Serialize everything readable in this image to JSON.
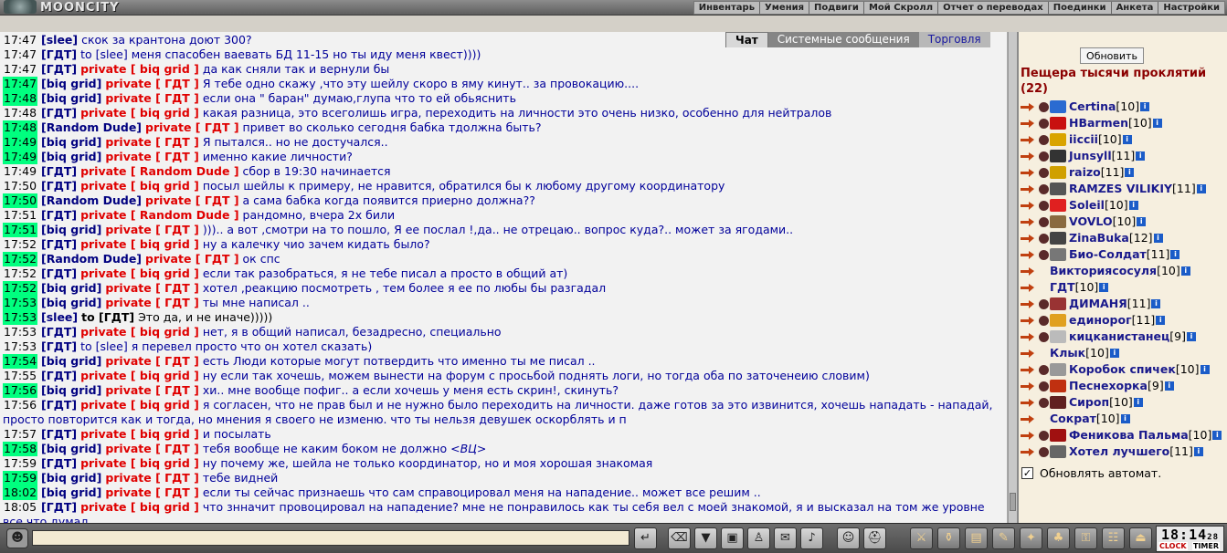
{
  "app": {
    "title": "MOONCITY"
  },
  "menu": [
    "Инвентарь",
    "Умения",
    "Подвиги",
    "Мой Скролл",
    "Отчет о переводах",
    "Поединки",
    "Анкета",
    "Настройки"
  ],
  "tabs": {
    "chat": "Чат",
    "system": "Системные сообщения",
    "trade": "Торговля"
  },
  "chat": [
    {
      "t": "17:47",
      "hl": false,
      "nick": "[slee]",
      "msg": "скок за крантона доют 300?"
    },
    {
      "t": "17:47",
      "hl": false,
      "nick": "[ГДТ]",
      "to": "to [slee]",
      "msg": "меня спасобен ваевать БД 11-15 но ты иду меня квест))))"
    },
    {
      "t": "17:47",
      "hl": false,
      "nick": "[ГДТ]",
      "priv": "private [ biq grid ]",
      "msg": "да как сняли так и вернули бы"
    },
    {
      "t": "17:47",
      "hl": true,
      "nick": "[biq grid]",
      "priv": "private [ ГДТ ]",
      "msg": "Я тебе одно скажу ,что эту шейлу скоро в яму кинут.. за провокацию...."
    },
    {
      "t": "17:48",
      "hl": true,
      "nick": "[biq grid]",
      "priv": "private [ ГДТ ]",
      "msg": "если она \" баран\" думаю,глупа что то ей обьяснить"
    },
    {
      "t": "17:48",
      "hl": false,
      "nick": "[ГДТ]",
      "priv": "private [ biq grid ]",
      "msg": "какая разница, это всеголишь игра, переходить на личности это очень низко, особенно для нейтралов"
    },
    {
      "t": "17:48",
      "hl": true,
      "nick": "[Random Dude]",
      "priv": "private [ ГДТ ]",
      "msg": "привет во сколько сегодня бабка тдолжна быть?"
    },
    {
      "t": "17:49",
      "hl": true,
      "nick": "[biq grid]",
      "priv": "private [ ГДТ ]",
      "msg": "Я пытался.. но не достучался.."
    },
    {
      "t": "17:49",
      "hl": true,
      "nick": "[biq grid]",
      "priv": "private [ ГДТ ]",
      "msg": "именно какие личности?"
    },
    {
      "t": "17:49",
      "hl": false,
      "nick": "[ГДТ]",
      "priv": "private [ Random Dude ]",
      "msg": "сбор в 19:30 начинается"
    },
    {
      "t": "17:50",
      "hl": false,
      "nick": "[ГДТ]",
      "priv": "private [ biq grid ]",
      "msg": "посыл шейлы к примеру, не нравится, обратился бы к любому другому координатору"
    },
    {
      "t": "17:50",
      "hl": true,
      "nick": "[Random Dude]",
      "priv": "private [ ГДТ ]",
      "msg": "а сама бабка когда появится приерно должна??"
    },
    {
      "t": "17:51",
      "hl": false,
      "nick": "[ГДТ]",
      "priv": "private [ Random Dude ]",
      "msg": "рандомно, вчера 2х били"
    },
    {
      "t": "17:51",
      "hl": true,
      "nick": "[biq grid]",
      "priv": "private [ ГДТ ]",
      "msg": "))).. а вот ,смотри на то пошло, Я ее послал !,да.. не отрецаю.. вопрос куда?.. может за ягодами.."
    },
    {
      "t": "17:52",
      "hl": false,
      "nick": "[ГДТ]",
      "priv": "private [ biq grid ]",
      "msg": "ну а калечку чио зачем кидать было?"
    },
    {
      "t": "17:52",
      "hl": true,
      "nick": "[Random Dude]",
      "priv": "private [ ГДТ ]",
      "msg": "ок спс"
    },
    {
      "t": "17:52",
      "hl": false,
      "nick": "[ГДТ]",
      "priv": "private [ biq grid ]",
      "msg": "если так разобраться, я не тебе писал а просто в общий ат)"
    },
    {
      "t": "17:52",
      "hl": true,
      "nick": "[biq grid]",
      "priv": "private [ ГДТ ]",
      "msg": "хотел ,реакцию посмотреть , тем более я ее по любы бы разгадал"
    },
    {
      "t": "17:53",
      "hl": true,
      "nick": "[biq grid]",
      "priv": "private [ ГДТ ]",
      "msg": "ты мне написал .."
    },
    {
      "t": "17:53",
      "hl": true,
      "nick": "[slee]",
      "to": "to [ГДТ]",
      "toDark": true,
      "msg": "Это да, и не иначе)))))",
      "dark": true
    },
    {
      "t": "17:53",
      "hl": false,
      "nick": "[ГДТ]",
      "priv": "private [ biq grid ]",
      "msg": "нет, я в общий написал, безадресно, специально"
    },
    {
      "t": "17:53",
      "hl": false,
      "nick": "[ГДТ]",
      "to": "to [slee]",
      "msg": "я перевел просто что он хотел сказать)"
    },
    {
      "t": "17:54",
      "hl": true,
      "nick": "[biq grid]",
      "priv": "private [ ГДТ ]",
      "msg": "есть Люди которые могут потвердить что именно ты ме писал .."
    },
    {
      "t": "17:55",
      "hl": false,
      "nick": "[ГДТ]",
      "priv": "private [ biq grid ]",
      "msg": "ну если так хочешь, можем вынести на форум с просьбой поднять логи, но тогда оба по заточенеию словим)"
    },
    {
      "t": "17:56",
      "hl": true,
      "nick": "[biq grid]",
      "priv": "private [ ГДТ ]",
      "msg": "хи.. мне вообще пофиг.. а если хочешь у меня есть скрин!, скинуть?"
    },
    {
      "t": "17:56",
      "hl": false,
      "wrap": true,
      "nick": "[ГДТ]",
      "priv": "private [ biq grid ]",
      "msg": "я согласен, что не прав был и не нужно было переходить на личности. даже готов за это извинится, хочешь нападать - нападай, просто повторится как и тогда, но мнения я своего не изменю. что ты нельзя девушек оскорблять и п"
    },
    {
      "t": "17:57",
      "hl": false,
      "nick": "[ГДТ]",
      "priv": "private [ biq grid ]",
      "msg": "и посылать"
    },
    {
      "t": "17:58",
      "hl": true,
      "nick": "[biq grid]",
      "priv": "private [ ГДТ ]",
      "msg": "тебя вообще не каким боком не должно",
      "em": "<ВЦ>"
    },
    {
      "t": "17:59",
      "hl": false,
      "nick": "[ГДТ]",
      "priv": "private [ biq grid ]",
      "msg": "ну почему же, шейла не только координатор, но и моя хорошая знакомая"
    },
    {
      "t": "17:59",
      "hl": true,
      "nick": "[biq grid]",
      "priv": "private [ ГДТ ]",
      "msg": "тебе видней"
    },
    {
      "t": "18:02",
      "hl": true,
      "nick": "[biq grid]",
      "priv": "private [ ГДТ ]",
      "msg": "если ты сейчас признаешь что сам справоцировал меня на нападение.. может все решим .."
    },
    {
      "t": "18:05",
      "hl": false,
      "wrap": true,
      "nick": "[ГДТ]",
      "priv": "private [ biq grid ]",
      "msg": "что знначит провоцировал на нападение? мне не понравилось как ты себя вел с моей знакомой, я и высказал на том же уровне все что думал"
    }
  ],
  "side": {
    "refresh": "Обновить",
    "room": "Пещера тысячи проклятий",
    "count": "(22)",
    "auto_refresh": "Обновлять автомат.",
    "users": [
      {
        "name": "Certina",
        "lvl": "[10]",
        "clan": "#2a6bd1"
      },
      {
        "name": "HBarmen",
        "lvl": "[10]",
        "clan": "#c81010"
      },
      {
        "name": "iiccii",
        "lvl": "[10]",
        "clan": "#d9a400"
      },
      {
        "name": "Junsyll",
        "lvl": "[11]",
        "clan": "#333333"
      },
      {
        "name": "raizo",
        "lvl": "[11]",
        "clan": "#d0a000"
      },
      {
        "name": "RAMZES VILIKIY",
        "lvl": "[11]",
        "clan": "#555555"
      },
      {
        "name": "Soleil",
        "lvl": "[10]",
        "clan": "#e02020"
      },
      {
        "name": "VOVLO",
        "lvl": "[10]",
        "clan": "#8a6a40"
      },
      {
        "name": "ZinaBuka",
        "lvl": "[12]",
        "clan": "#444444"
      },
      {
        "name": "Био-Солдат",
        "lvl": "[11]",
        "clan": "#777777"
      },
      {
        "name": "Викториясосуля",
        "lvl": "[10]",
        "clan": ""
      },
      {
        "name": "ГДТ",
        "lvl": "[10]",
        "clan": ""
      },
      {
        "name": "ДИМАНЯ",
        "lvl": "[11]",
        "clan": "#993333"
      },
      {
        "name": "единорог",
        "lvl": "[11]",
        "clan": "#e0a020"
      },
      {
        "name": "кицканистанец",
        "lvl": "[9]",
        "clan": "#bbbbbb"
      },
      {
        "name": "Клык",
        "lvl": "[10]",
        "clan": ""
      },
      {
        "name": "Коробок спичек",
        "lvl": "[10]",
        "clan": "#999999"
      },
      {
        "name": "Песнехорка",
        "lvl": "[9]",
        "clan": "#c03010"
      },
      {
        "name": "Сироп",
        "lvl": "[10]",
        "clan": "#602020"
      },
      {
        "name": "Сократ",
        "lvl": "[10]",
        "clan": ""
      },
      {
        "name": "Феникова Пальма",
        "lvl": "[10]",
        "clan": "#a01010"
      },
      {
        "name": "Хотел лучшего",
        "lvl": "[11]",
        "clan": "#666666"
      }
    ]
  },
  "clock": {
    "time": "18:14",
    "sec": "28",
    "clock_label": "CLOCK",
    "timer_label": "TIMER"
  },
  "input": {
    "value": ""
  }
}
